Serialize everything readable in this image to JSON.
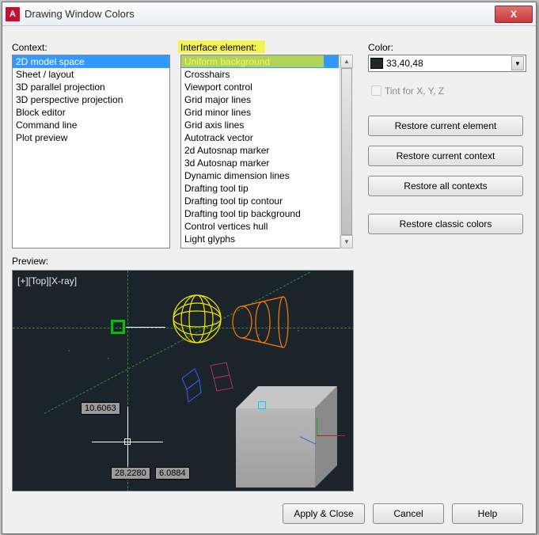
{
  "window": {
    "app_glyph": "A",
    "title": "Drawing Window Colors",
    "close": "X"
  },
  "labels": {
    "context": "Context:",
    "interface": "Interface element:",
    "color": "Color:",
    "tint": "Tint for X, Y, Z",
    "preview": "Preview:"
  },
  "context_items": [
    "2D model space",
    "Sheet / layout",
    "3D parallel projection",
    "3D perspective projection",
    "Block editor",
    "Command line",
    "Plot preview"
  ],
  "context_selected": 0,
  "interface_items": [
    "Uniform background",
    "Crosshairs",
    "Viewport control",
    "Grid major lines",
    "Grid minor lines",
    "Grid axis lines",
    "Autotrack vector",
    "2d Autosnap marker",
    "3d Autosnap marker",
    "Dynamic dimension lines",
    "Drafting tool tip",
    "Drafting tool tip contour",
    "Drafting tool tip background",
    "Control vertices hull",
    "Light glyphs"
  ],
  "interface_selected": 0,
  "color": {
    "name": "33,40,48",
    "hex": "#212830"
  },
  "buttons": {
    "restore_element": "Restore current element",
    "restore_context": "Restore current context",
    "restore_all": "Restore all contexts",
    "restore_classic": "Restore classic colors",
    "apply": "Apply & Close",
    "cancel": "Cancel",
    "help": "Help"
  },
  "preview": {
    "viewport_label": "[+][Top][X-ray]",
    "dim1": "10.6063",
    "dim2": "28.2280",
    "dim3": "6.0884"
  }
}
